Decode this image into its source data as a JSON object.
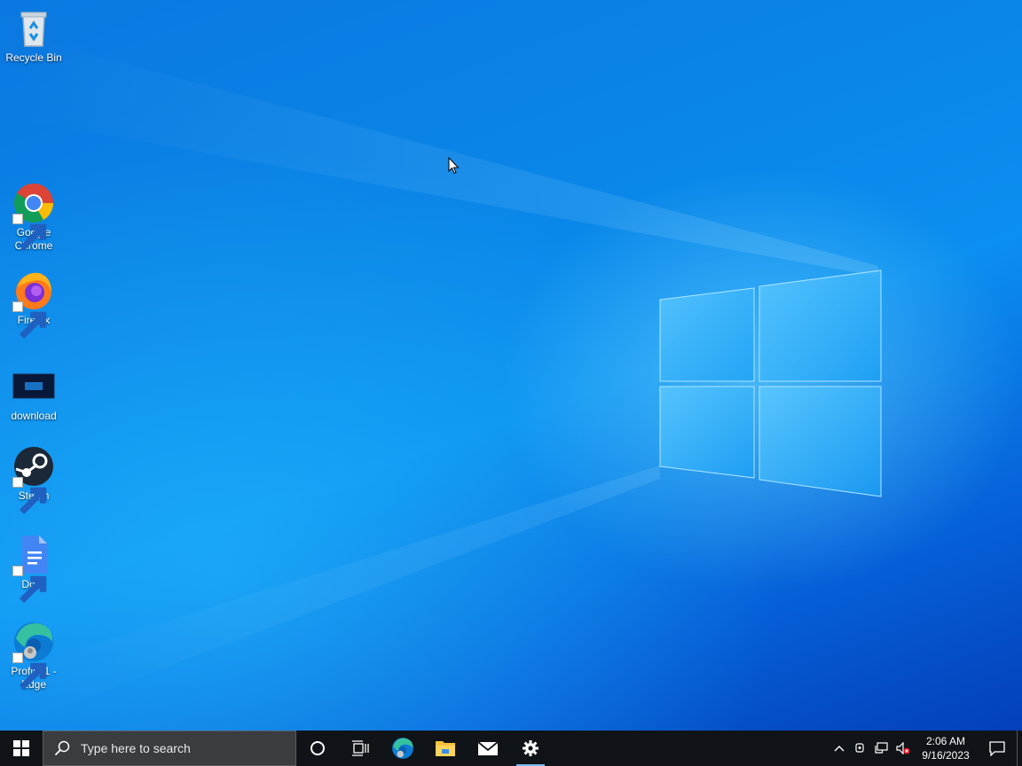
{
  "desktop": {
    "icons": [
      {
        "label": "Recycle Bin",
        "icon": "recycle-bin-icon"
      },
      {
        "label": "Google Chrome",
        "icon": "chrome-icon"
      },
      {
        "label": "Firefox",
        "icon": "firefox-icon"
      },
      {
        "label": "download",
        "icon": "image-file-icon"
      },
      {
        "label": "Steam",
        "icon": "steam-icon"
      },
      {
        "label": "Docs",
        "icon": "docs-icon"
      },
      {
        "label": "Profile 1 - Edge",
        "icon": "edge-icon"
      }
    ]
  },
  "taskbar": {
    "search_placeholder": "Type here to search",
    "pinned": [
      "cortana-icon",
      "task-view-icon",
      "edge-icon",
      "file-explorer-icon",
      "mail-icon",
      "settings-icon"
    ],
    "active": "settings-icon",
    "clock": {
      "time": "2:06 AM",
      "date": "9/16/2023"
    }
  },
  "colors": {
    "taskbar": "#101418",
    "accent": "#76b9ed",
    "wallpaper": "#0a86e8"
  }
}
